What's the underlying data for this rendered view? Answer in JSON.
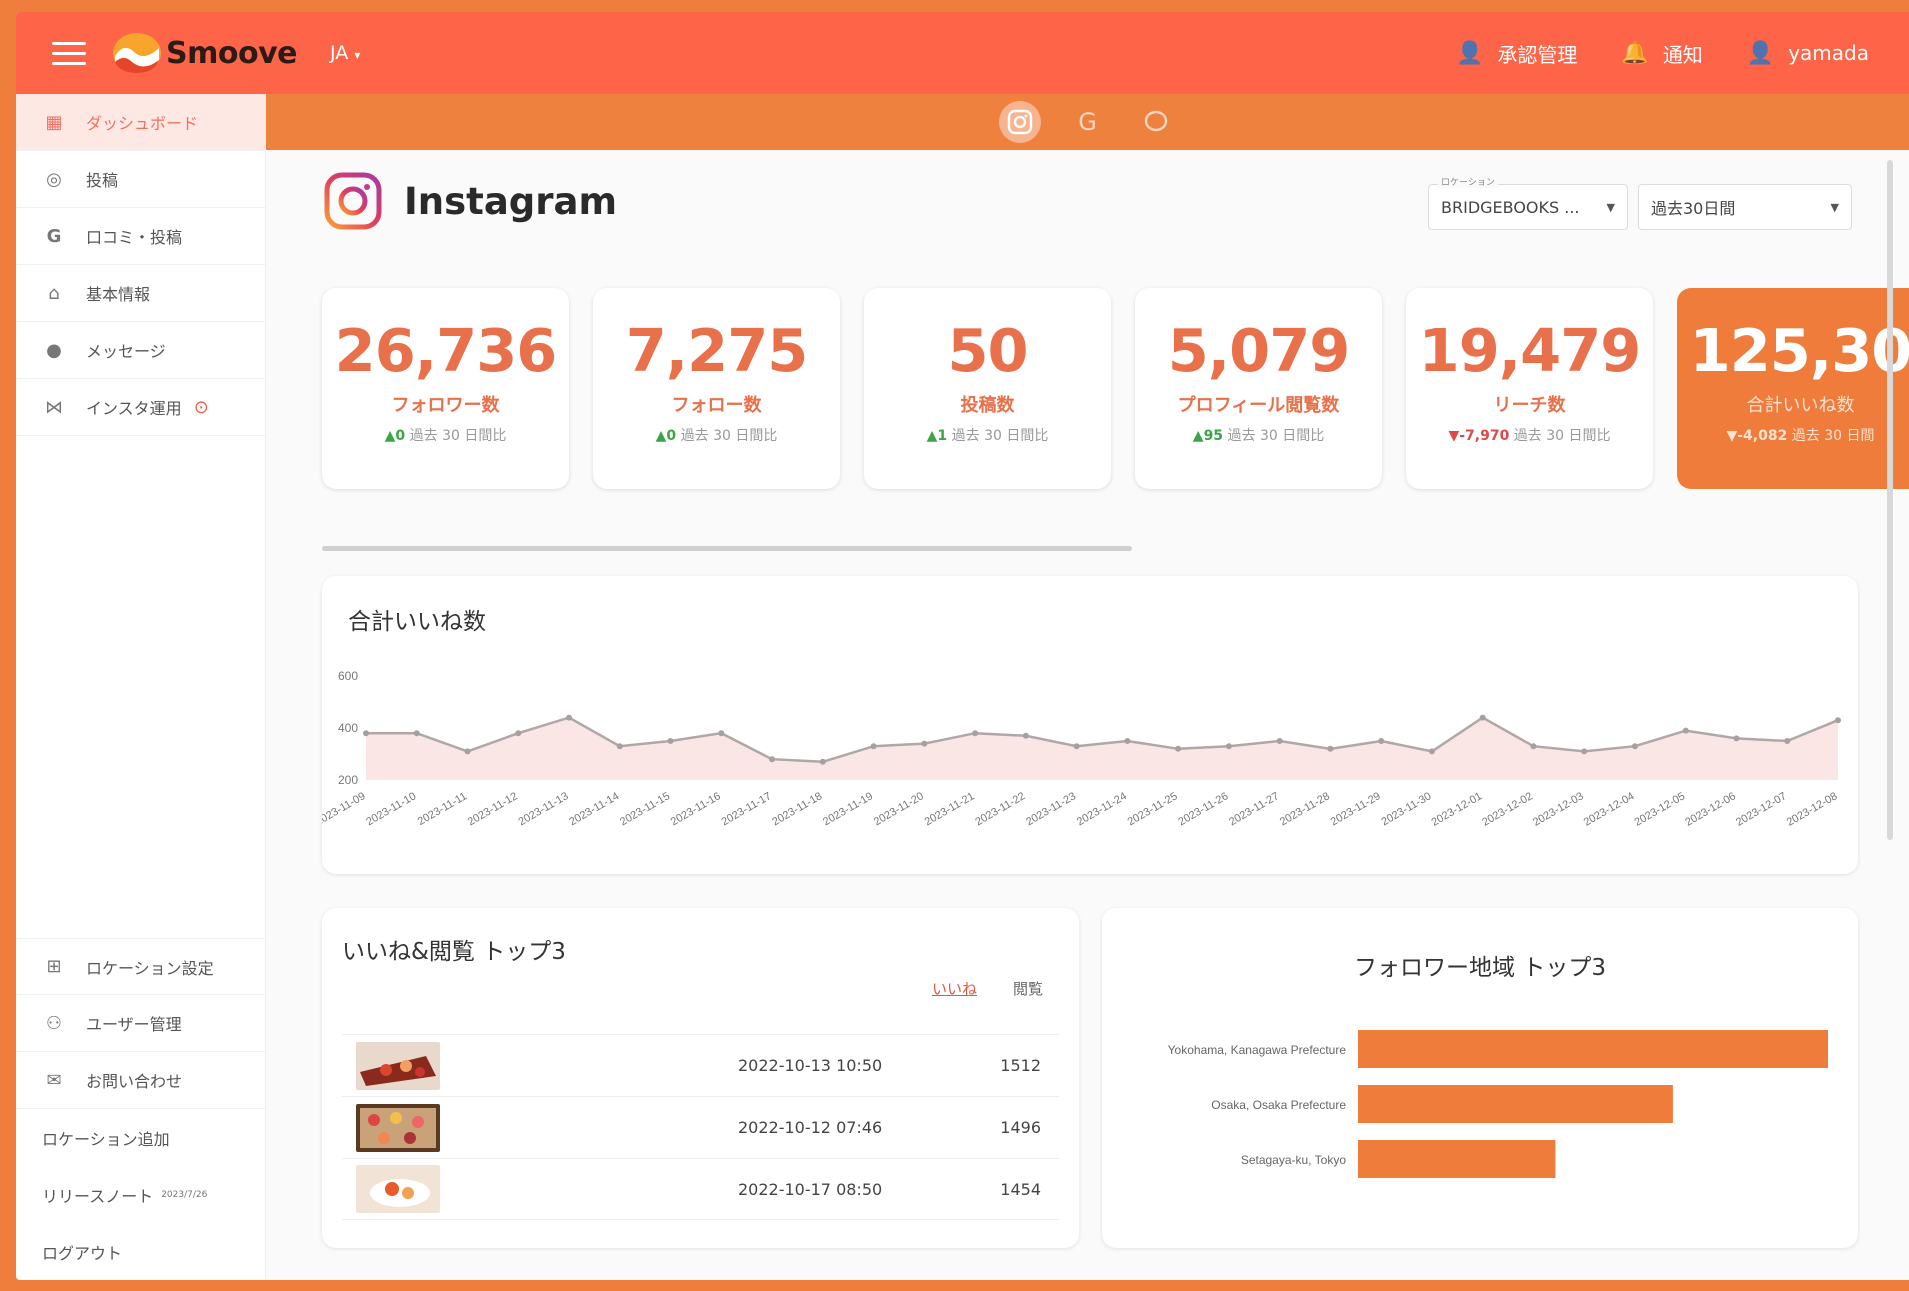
{
  "header": {
    "brand": "Smoove",
    "lang": "JA",
    "approval": "承認管理",
    "notice": "通知",
    "user": "yamada"
  },
  "sidebar": {
    "items": [
      {
        "label": "ダッシュボード",
        "icon": "dashboard-icon"
      },
      {
        "label": "投稿",
        "icon": "instagram-icon"
      },
      {
        "label": "口コミ・投稿",
        "icon": "google-icon"
      },
      {
        "label": "基本情報",
        "icon": "store-icon"
      },
      {
        "label": "メッセージ",
        "icon": "chat-icon"
      },
      {
        "label": "インスタ運用",
        "icon": "workflow-icon"
      }
    ],
    "bottom": [
      {
        "label": "ロケーション設定",
        "icon": "location-settings-icon"
      },
      {
        "label": "ユーザー管理",
        "icon": "user-manage-icon"
      },
      {
        "label": "お問い合わせ",
        "icon": "mail-icon"
      }
    ],
    "add_location": "ロケーション追加",
    "release_notes": "リリースノート",
    "release_date": "2023/7/26",
    "logout": "ログアウト"
  },
  "page": {
    "title": "Instagram",
    "location_label": "ロケーション",
    "location_value": "BRIDGEBOOKS ...",
    "period_value": "過去30日間"
  },
  "cards": [
    {
      "value": "26,736",
      "label": "フォロワー数",
      "delta": "0",
      "dir": "up",
      "note": "過去 30 日間比"
    },
    {
      "value": "7,275",
      "label": "フォロー数",
      "delta": "0",
      "dir": "up",
      "note": "過去 30 日間比"
    },
    {
      "value": "50",
      "label": "投稿数",
      "delta": "1",
      "dir": "up",
      "note": "過去 30 日間比"
    },
    {
      "value": "5,079",
      "label": "プロフィール閲覧数",
      "delta": "95",
      "dir": "up",
      "note": "過去 30 日間比"
    },
    {
      "value": "19,479",
      "label": "リーチ数",
      "delta": "-7,970",
      "dir": "down",
      "note": "過去 30 日間比"
    },
    {
      "value": "125,30",
      "label": "合計いいね数",
      "delta": "-4,082",
      "dir": "down",
      "note": "過去 30 日間"
    }
  ],
  "line_panel": {
    "title": "合計いいね数"
  },
  "top3": {
    "title": "いいね&閲覧 トップ3",
    "tab_likes": "いいね",
    "tab_views": "閲覧",
    "rows": [
      {
        "date": "2022-10-13 10:50",
        "value": "1512"
      },
      {
        "date": "2022-10-12 07:46",
        "value": "1496"
      },
      {
        "date": "2022-10-17 08:50",
        "value": "1454"
      }
    ]
  },
  "region": {
    "title": "フォロワー地域 トップ3"
  },
  "colors": {
    "topbar": "#fe6447",
    "accent": "#ef7c3b",
    "line": "#b0a7a7",
    "fill": "#f9dcdc",
    "bar": "#ef7c3b"
  },
  "chart_data": [
    {
      "type": "area",
      "ylim": [
        200,
        600
      ],
      "yticks": [
        200,
        400,
        600
      ],
      "x": [
        "2023-11-09",
        "2023-11-10",
        "2023-11-11",
        "2023-11-12",
        "2023-11-13",
        "2023-11-14",
        "2023-11-15",
        "2023-11-16",
        "2023-11-17",
        "2023-11-18",
        "2023-11-19",
        "2023-11-20",
        "2023-11-21",
        "2023-11-22",
        "2023-11-23",
        "2023-11-24",
        "2023-11-25",
        "2023-11-26",
        "2023-11-27",
        "2023-11-28",
        "2023-11-29",
        "2023-11-30",
        "2023-12-01",
        "2023-12-02",
        "2023-12-03",
        "2023-12-04",
        "2023-12-05",
        "2023-12-06",
        "2023-12-07",
        "2023-12-08"
      ],
      "values": [
        380,
        380,
        310,
        380,
        440,
        330,
        350,
        380,
        280,
        270,
        330,
        340,
        380,
        370,
        330,
        350,
        320,
        330,
        350,
        320,
        350,
        310,
        440,
        330,
        310,
        330,
        390,
        360,
        350,
        430
      ]
    },
    {
      "type": "bar",
      "orientation": "horizontal",
      "categories": [
        "Yokohama, Kanagawa Prefecture",
        "Osaka, Osaka Prefecture",
        "Setagaya-ku, Tokyo"
      ],
      "values": [
        100,
        67,
        42
      ]
    }
  ]
}
